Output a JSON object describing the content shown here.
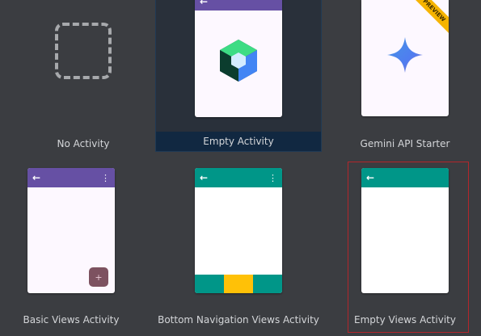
{
  "templates": [
    {
      "label": "No Activity"
    },
    {
      "label": "Empty Activity"
    },
    {
      "label": "Gemini API Starter",
      "badge": "PREVIEW"
    },
    {
      "label": "Basic Views Activity",
      "fab_icon": "+"
    },
    {
      "label": "Bottom Navigation Views Activity"
    },
    {
      "label": "Empty Views Activity"
    }
  ],
  "icons": {
    "back": "←",
    "overflow": "⋮"
  },
  "colors": {
    "background": "#3b3d41",
    "selected_tile": "#29303a",
    "selected_band": "#112841",
    "appbar_purple": "#6650a4",
    "appbar_teal": "#009688",
    "nav_highlight": "#ffc107",
    "highlight_border": "#b3262b"
  }
}
